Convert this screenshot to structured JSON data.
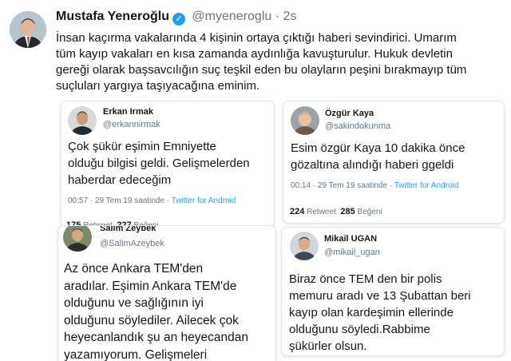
{
  "main_tweet": {
    "name": "Mustafa Yeneroğlu",
    "verified_mark": "✓",
    "handle": "@myeneroglu",
    "separator": " · ",
    "time": "2s",
    "lines": [
      "İnsan kaçırma vakalarında 4 kişinin ortaya çıktığı haberi sevindirici.  Umarım",
      "tüm kayıp vakaları en kısa zamanda aydınlığa kavuşturulur. Hukuk devletin",
      "gereği olarak başsavcılığın  suç teşkil eden bu olayların peşini bırakmayıp tüm",
      "suçluları yargıya taşıyacağına eminim."
    ]
  },
  "cards": {
    "erkan": {
      "name": "Erkan Irmak",
      "handle": "@erkannirmak",
      "lines": [
        "Çok şükür eşimin Emniyette",
        "olduğu bilgisi geldi. Gelişmelerden",
        "haberdar edeceğim"
      ],
      "time": "00:57 · 29 Tem 19 saatinde · ",
      "client": "Twitter for Android",
      "retweets": "175",
      "retweets_label": "Retweet",
      "likes": "227",
      "likes_label": "Beğeni"
    },
    "ozgur": {
      "name": "Özgür Kaya",
      "handle": "@sakindokunma",
      "lines": [
        "Esim özgür Kaya 10 dakika önce",
        "gözaltına alındığı haberi ggeldi"
      ],
      "time": "00:14 · 29 Tem 19 saatinde · ",
      "client": "Twitter for Android",
      "retweets": "224",
      "retweets_label": "Retweet",
      "likes": "285",
      "likes_label": "Beğeni"
    },
    "salim": {
      "name": "Salim Zeybek",
      "handle": "@SalimAzeybek",
      "lines": [
        "Az önce Ankara TEM'den",
        "aradılar. Eşimin Ankara TEM'de",
        "olduğunu ve sağlığının iyi",
        "olduğunu söylediler. Ailecek çok",
        "heyecanlandık şu an heyecandan",
        "yazamıyorum. Gelişmeleri"
      ]
    },
    "mikail": {
      "name": "Mikail UGAN",
      "handle": "@mikail_ugan",
      "lines": [
        "Biraz önce TEM den bir polis",
        "memuru aradı ve 13 Şubattan beri",
        "kayıp olan  kardeşimin ellerinde",
        "olduğunu söyledi.Rabbime",
        "şükürler olsun."
      ]
    }
  }
}
